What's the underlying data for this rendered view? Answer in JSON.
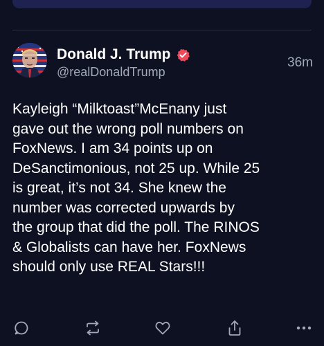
{
  "post": {
    "author": {
      "display_name": "Donald J. Trump",
      "handle": "@realDonaldTrump",
      "verified": true,
      "avatar_icon": "avatar-photo"
    },
    "timestamp": "36m",
    "text": "Kayleigh “Milktoast”McEnany just\ngave out the wrong poll numbers on\nFoxNews. I am 34 points up on\nDeSanctimonious, not 25 up. While 25\nis great, it’s not 34. She knew the\nnumber was corrected upwards by\nthe group that did the poll. The RINOS\n& Globalists can have her. FoxNews\nshould only use REAL Stars!!!",
    "actions": [
      {
        "name": "reply",
        "icon": "reply-icon"
      },
      {
        "name": "retruth",
        "icon": "retruth-icon"
      },
      {
        "name": "like",
        "icon": "heart-icon"
      },
      {
        "name": "share",
        "icon": "share-icon"
      },
      {
        "name": "more",
        "icon": "more-icon"
      }
    ]
  },
  "colors": {
    "background": "#0e1122",
    "text_primary": "#ffffff",
    "text_secondary": "#a3a9bd",
    "verified_badge": "#f04a5a",
    "icon": "#a3a9bd"
  }
}
